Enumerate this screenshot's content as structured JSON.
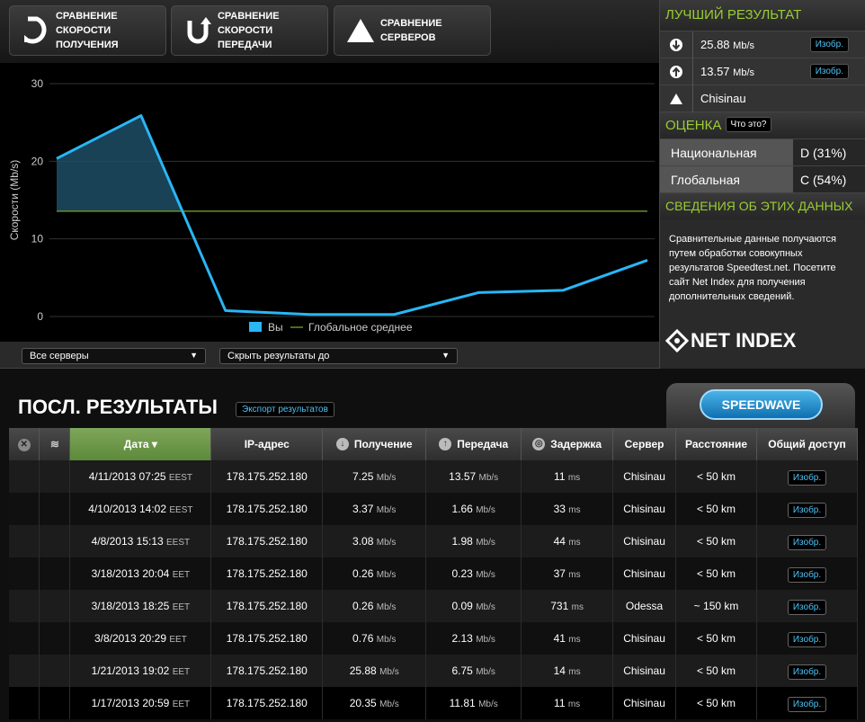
{
  "tabs": [
    {
      "label_l1": "СРАВНЕНИЕ СКОРОСТИ",
      "label_l2": "ПОЛУЧЕНИЯ"
    },
    {
      "label_l1": "СРАВНЕНИЕ СКОРОСТИ",
      "label_l2": "ПЕРЕДАЧИ"
    },
    {
      "label_l1": "СРАВНЕНИЕ",
      "label_l2": "СЕРВЕРОВ"
    }
  ],
  "chart_data": {
    "type": "line",
    "ylabel": "Скорости (Mb/s)",
    "ylim": [
      0,
      30
    ],
    "yticks": [
      "0",
      "10",
      "20",
      "30"
    ],
    "series": [
      {
        "name": "Вы",
        "values": [
          20.35,
          25.88,
          0.76,
          0.26,
          0.26,
          3.08,
          3.37,
          7.25
        ]
      }
    ],
    "global_average": 13.57,
    "legend": {
      "you": "Вы",
      "avg": "Глобальное среднее"
    },
    "colors": {
      "you": "#29b6f6",
      "avg": "#6b8e23"
    }
  },
  "filters": {
    "servers": "Все серверы",
    "hide": "Скрыть результаты до"
  },
  "best": {
    "title": "ЛУЧШИЙ РЕЗУЛЬТАТ",
    "download": "25.88",
    "download_unit": "Mb/s",
    "upload": "13.57",
    "upload_unit": "Mb/s",
    "server": "Chisinau",
    "img_btn": "Изобр."
  },
  "grade": {
    "title": "ОЦЕНКА",
    "what": "Что это?",
    "national_label": "Национальная",
    "national_value": "D (31%)",
    "global_label": "Глобальная",
    "global_value": "C (54%)"
  },
  "about": {
    "title": "СВЕДЕНИЯ ОБ ЭТИХ ДАННЫХ",
    "text": "Сравнительные данные получаются путем обработки совокупных результатов Speedtest.net. Посетите сайт Net Index для получения дополнительных сведений.",
    "logo": "NET INDEX"
  },
  "results": {
    "title": "ПОСЛ. РЕЗУЛЬТАТЫ",
    "export": "Экспорт результатов",
    "speedwave": "SPEEDWAVE",
    "columns": [
      "Дата ▾",
      "IP-адрес",
      "Получение",
      "Передача",
      "Задержка",
      "Сервер",
      "Расстояние",
      "Общий доступ"
    ],
    "rows": [
      {
        "date": "4/11/2013 07:25",
        "tz": "EEST",
        "ip": "178.175.252.180",
        "dl": "7.25",
        "ul": "13.57",
        "ping": "11",
        "server": "Chisinau",
        "dist": "< 50 km"
      },
      {
        "date": "4/10/2013 14:02",
        "tz": "EEST",
        "ip": "178.175.252.180",
        "dl": "3.37",
        "ul": "1.66",
        "ping": "33",
        "server": "Chisinau",
        "dist": "< 50 km"
      },
      {
        "date": "4/8/2013 15:13",
        "tz": "EEST",
        "ip": "178.175.252.180",
        "dl": "3.08",
        "ul": "1.98",
        "ping": "44",
        "server": "Chisinau",
        "dist": "< 50 km"
      },
      {
        "date": "3/18/2013 20:04",
        "tz": "EET",
        "ip": "178.175.252.180",
        "dl": "0.26",
        "ul": "0.23",
        "ping": "37",
        "server": "Chisinau",
        "dist": "< 50 km"
      },
      {
        "date": "3/18/2013 18:25",
        "tz": "EET",
        "ip": "178.175.252.180",
        "dl": "0.26",
        "ul": "0.09",
        "ping": "731",
        "server": "Odessa",
        "dist": "~ 150 km"
      },
      {
        "date": "3/8/2013 20:29",
        "tz": "EET",
        "ip": "178.175.252.180",
        "dl": "0.76",
        "ul": "2.13",
        "ping": "41",
        "server": "Chisinau",
        "dist": "< 50 km"
      },
      {
        "date": "1/21/2013 19:02",
        "tz": "EET",
        "ip": "178.175.252.180",
        "dl": "25.88",
        "ul": "6.75",
        "ping": "14",
        "server": "Chisinau",
        "dist": "< 50 km"
      },
      {
        "date": "1/17/2013 20:59",
        "tz": "EET",
        "ip": "178.175.252.180",
        "dl": "20.35",
        "ul": "11.81",
        "ping": "11",
        "server": "Chisinau",
        "dist": "< 50 km"
      }
    ],
    "unit": "Mb/s",
    "ms": "ms",
    "share": "Изобр."
  }
}
